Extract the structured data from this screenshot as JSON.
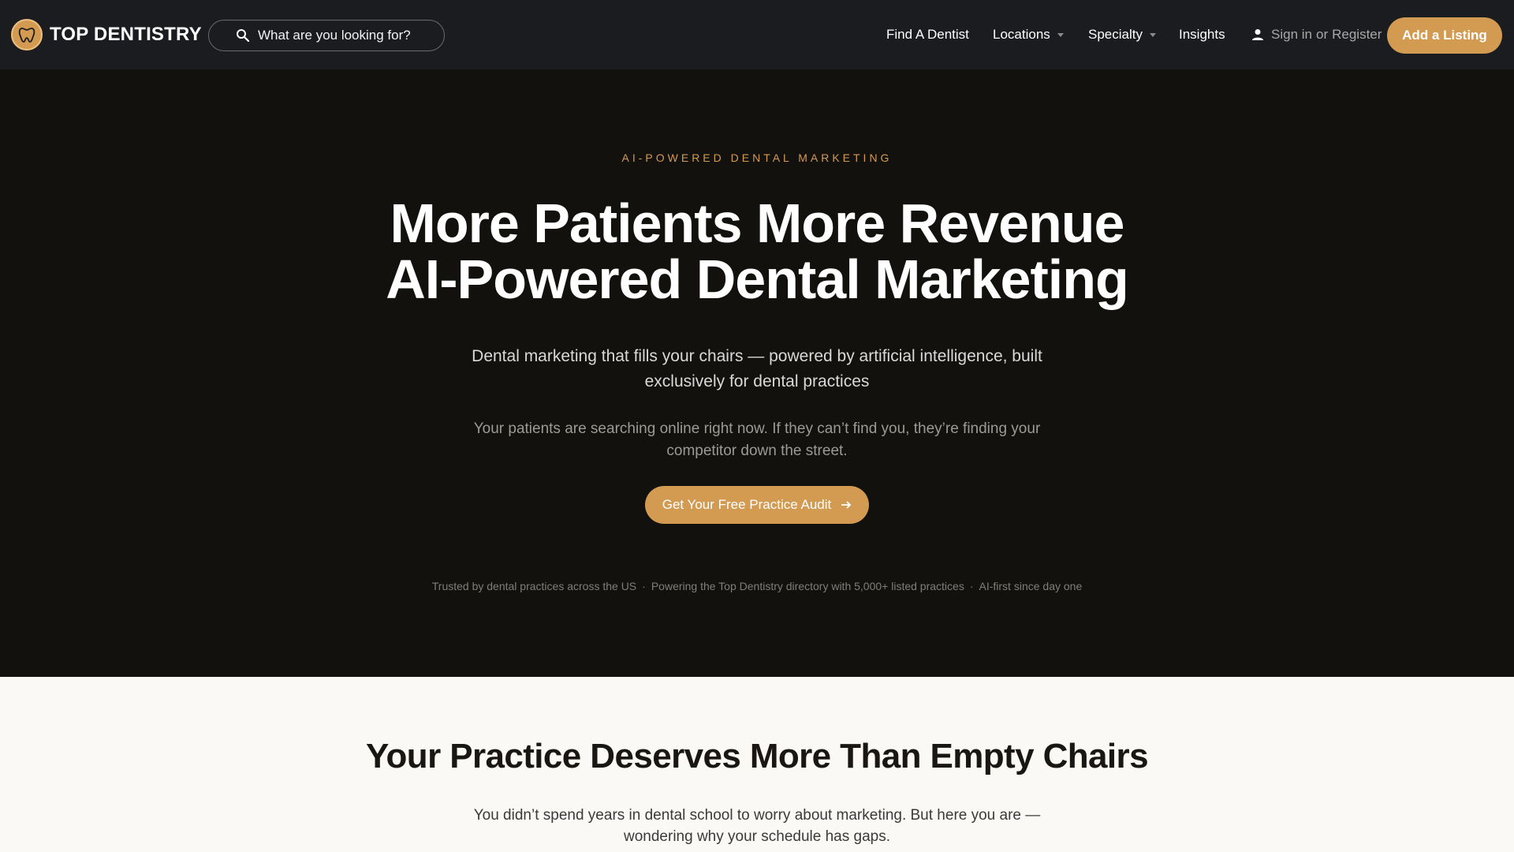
{
  "brand": {
    "name": "TOP DENTISTRY",
    "accent": "#d39a52",
    "header_bg": "#1b1c20",
    "hero_bg": "#12110e"
  },
  "search": {
    "placeholder": "What are you looking for?",
    "icon": "search-icon"
  },
  "nav": {
    "find_dentist": "Find A Dentist",
    "locations": "Locations",
    "specialty": "Specialty",
    "insights": "Insights",
    "sign_in": "Sign in",
    "or": "or",
    "register": "Register",
    "add_listing": "Add a Listing"
  },
  "hero": {
    "eyebrow": "AI-POWERED DENTAL MARKETING",
    "title_line1": "More Patients More Revenue",
    "title_line2": "AI-Powered Dental Marketing",
    "subtitle": "Dental marketing that fills your chairs — powered by artificial intelligence, built exclusively for dental practices",
    "body": "Your patients are searching online right now. If they can’t find you, they’re finding your competitor down the street.",
    "cta": "Get Your Free Practice Audit",
    "trust": [
      "Trusted by dental practices across the US",
      "Powering the Top Dentistry directory with 5,000+ listed practices",
      "AI-first since day one"
    ]
  },
  "section2": {
    "title": "Your Practice Deserves More Than Empty Chairs",
    "body": "You didn’t spend years in dental school to worry about marketing. But here you are — wondering why your schedule has gaps."
  }
}
